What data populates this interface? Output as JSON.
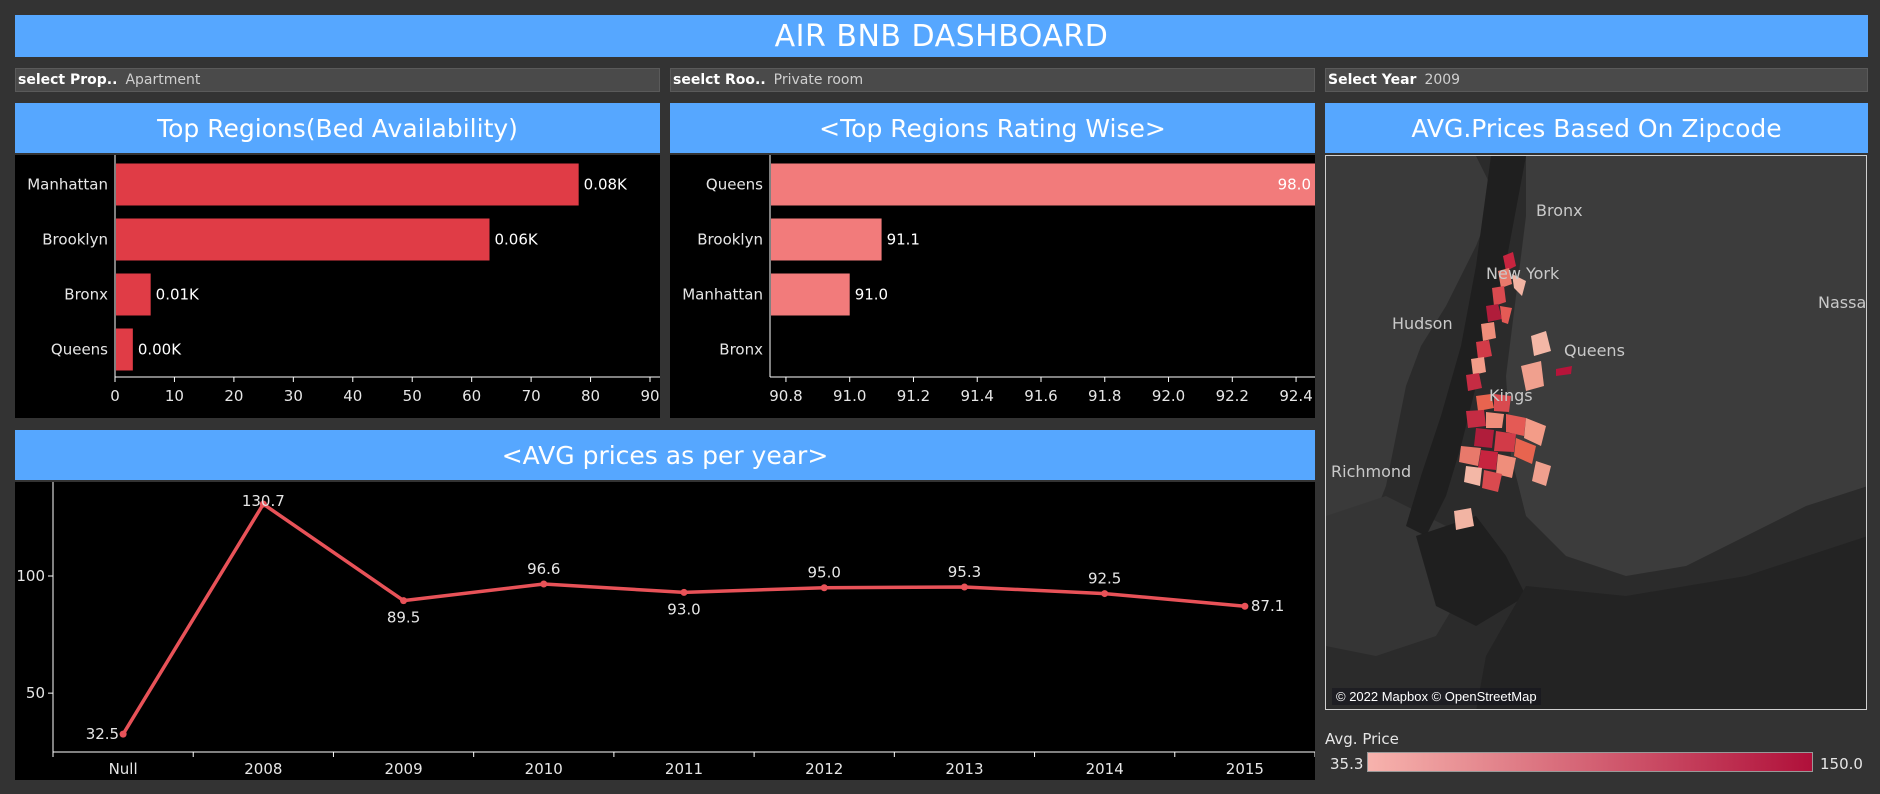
{
  "header": {
    "title": "AIR BNB DASHBOARD"
  },
  "filters": [
    {
      "label": "select Prop..",
      "value": "Apartment"
    },
    {
      "label": "seelct Roo..",
      "value": "Private room"
    },
    {
      "label": "Select Year",
      "value": "2009"
    }
  ],
  "panels": {
    "beds_title": "Top Regions(Bed Availability)",
    "rating_title": "<Top Regions Rating Wise>",
    "map_title": "AVG.Prices Based On Zipcode",
    "year_title": "<AVG prices as per year>"
  },
  "map": {
    "labels": [
      "Bronx",
      "New York",
      "Hudson",
      "Queens",
      "Nassa",
      "Kings",
      "Richmond"
    ],
    "credit": "© 2022 Mapbox © OpenStreetMap",
    "legend": {
      "title": "Avg. Price",
      "min": "35.3",
      "max": "150.0",
      "color_low": "#f7b3ad",
      "color_high": "#b0103a"
    }
  },
  "colors": {
    "banner": "#56a7ff",
    "bed_bar": "#e03c46",
    "rating_bar": "#f27b7b",
    "line": "#e85258"
  },
  "chart_data": [
    {
      "type": "bar",
      "orientation": "horizontal",
      "title": "Top Regions(Bed Availability)",
      "categories": [
        "Manhattan",
        "Brooklyn",
        "Bronx",
        "Queens"
      ],
      "values": [
        78,
        63,
        6,
        3
      ],
      "data_labels": [
        "0.08K",
        "0.06K",
        "0.01K",
        "0.00K"
      ],
      "xlim": [
        0,
        90
      ],
      "xticks": [
        0,
        10,
        20,
        30,
        40,
        50,
        60,
        70,
        80,
        90
      ]
    },
    {
      "type": "bar",
      "orientation": "horizontal",
      "title": "<Top Regions Rating Wise>",
      "categories": [
        "Queens",
        "Brooklyn",
        "Manhattan",
        "Bronx"
      ],
      "values": [
        98.0,
        91.1,
        91.0,
        null
      ],
      "data_labels": [
        "98.0",
        "91.1",
        "91.0",
        ""
      ],
      "xlim": [
        90.75,
        92.45
      ],
      "xticks": [
        "90.8",
        "91.0",
        "91.2",
        "91.4",
        "91.6",
        "91.8",
        "92.0",
        "92.2",
        "92.4"
      ]
    },
    {
      "type": "line",
      "title": "<AVG prices as per year>",
      "categories": [
        "Null",
        "2008",
        "2009",
        "2010",
        "2011",
        "2012",
        "2013",
        "2014",
        "2015"
      ],
      "values": [
        32.5,
        130.7,
        89.5,
        96.6,
        93.0,
        95.0,
        95.3,
        92.5,
        87.1
      ],
      "data_labels": [
        "32.5",
        "130.7",
        "89.5",
        "96.6",
        "93.0",
        "95.0",
        "95.3",
        "92.5",
        "87.1"
      ],
      "ylim": [
        30,
        135
      ],
      "yticks": [
        "100",
        "50"
      ]
    }
  ]
}
